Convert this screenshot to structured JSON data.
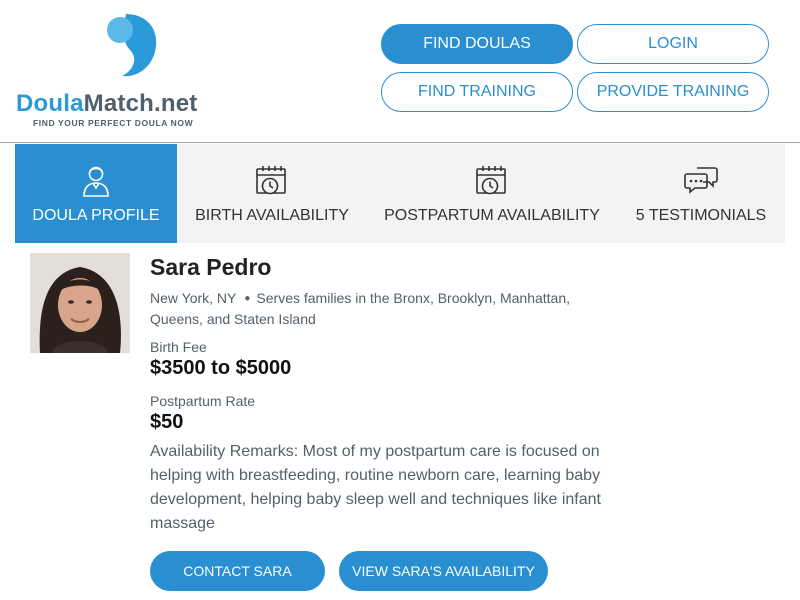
{
  "header": {
    "logo": {
      "brand_part1": "Doula",
      "brand_part2": "Match.net",
      "tagline": "FIND YOUR PERFECT DOULA NOW"
    },
    "nav": {
      "find_doulas": "FIND DOULAS",
      "login": "LOGIN",
      "find_training": "FIND TRAINING",
      "provide_training": "PROVIDE TRAINING"
    }
  },
  "tabs": [
    {
      "label": "DOULA PROFILE",
      "icon": "person-icon",
      "active": true
    },
    {
      "label": "BIRTH AVAILABILITY",
      "icon": "calendar-clock-icon",
      "active": false
    },
    {
      "label": "POSTPARTUM AVAILABILITY",
      "icon": "calendar-clock-icon",
      "active": false
    },
    {
      "label": "5 TESTIMONIALS",
      "icon": "chat-bubbles-icon",
      "active": false
    }
  ],
  "profile": {
    "name": "Sara Pedro",
    "city": "New York, NY",
    "service_area": "Serves families in the Bronx, Brooklyn, Manhattan, Queens, and Staten Island",
    "birth_fee_label": "Birth Fee",
    "birth_fee": "$3500 to $5000",
    "postpartum_label": "Postpartum Rate",
    "postpartum_rate": "$50",
    "remarks": "Availability Remarks: Most of my postpartum care is focused on helping with breastfeeding, routine newborn care, learning baby development, helping baby sleep well and techniques like infant massage"
  },
  "actions": {
    "contact": "CONTACT SARA",
    "availability": "VIEW SARA'S AVAILABILITY"
  },
  "colors": {
    "accent": "#2a8fd1",
    "logo_blue": "#2a9ad8",
    "logo_gray": "#4e5f6d",
    "tab_bg": "#f2f3f4"
  }
}
